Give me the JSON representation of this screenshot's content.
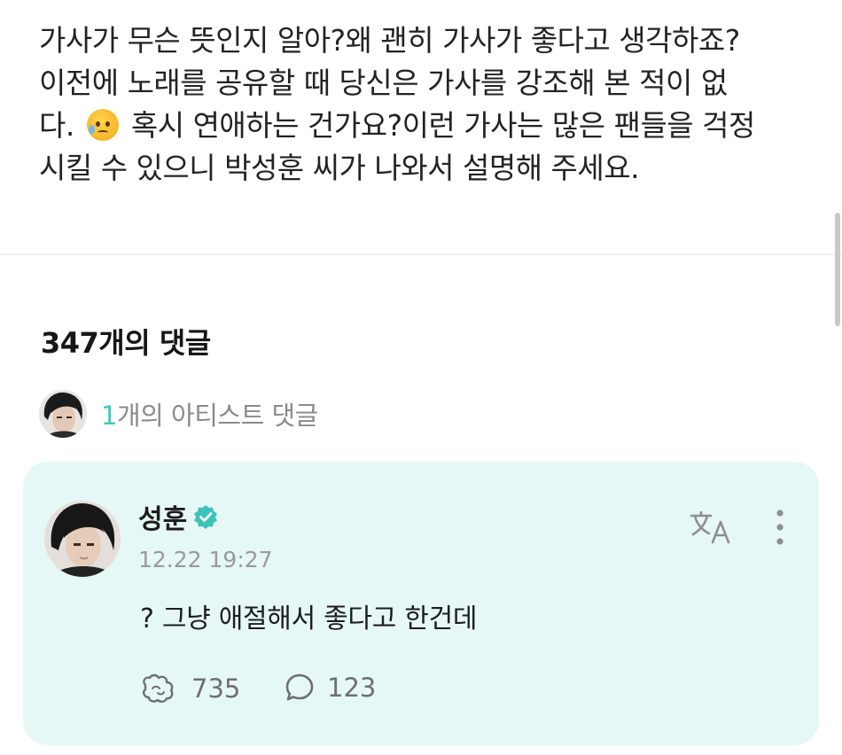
{
  "post": {
    "lines": [
      "가사가 무슨 뜻인지 알아?왜 괜히 가사가 좋다고 생각하죠?",
      "이전에 노래를 공유할 때 당신은 가사를 강조해 본 적이 없",
      "다.",
      "혹시 연애하는 건가요?이런 가사는 많은 팬들을 걱정",
      "시킬 수 있으니 박성훈 씨가 나와서 설명해 주세요."
    ]
  },
  "comments": {
    "count_label": "347개의 댓글",
    "artist_count": "1",
    "artist_label": "개의 아티스트 댓글"
  },
  "artist_comment": {
    "name": "성훈",
    "timestamp": "12.22 19:27",
    "text": "? 그냥 애절해서 좋다고 한건데",
    "likes": "735",
    "replies": "123"
  },
  "icons": {
    "verified": "verified-badge-icon",
    "translate": "translate-icon",
    "more": "more-vertical-icon",
    "like": "like-icon",
    "reply": "reply-bubble-icon",
    "emoji": "sad-sweat-emoji-icon"
  },
  "colors": {
    "card_bg": "#e6f8f6",
    "accent": "#39c9c0",
    "verified": "#3bc3ba"
  }
}
